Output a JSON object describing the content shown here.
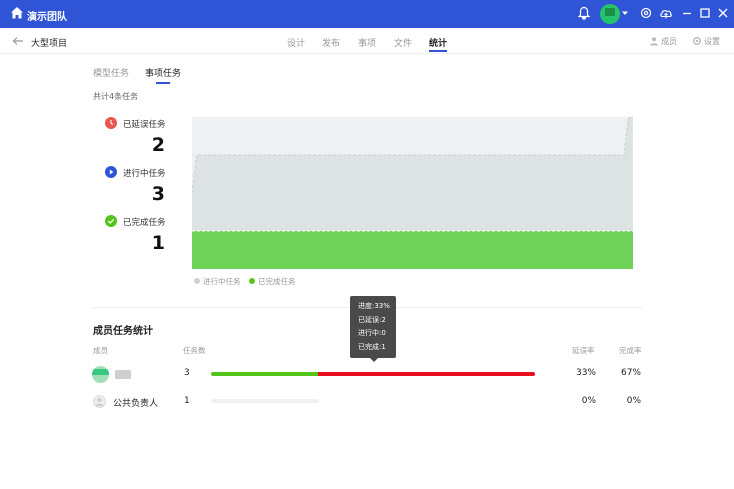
{
  "topbar": {
    "team_name": "演示团队",
    "bg": "#2f54d6"
  },
  "subnav": {
    "project": "大型项目",
    "tabs": [
      {
        "label": "设计",
        "active": false
      },
      {
        "label": "发布",
        "active": false
      },
      {
        "label": "事项",
        "active": false
      },
      {
        "label": "文件",
        "active": false
      },
      {
        "label": "统计",
        "active": true
      }
    ],
    "members_label": "成员",
    "settings_label": "设置"
  },
  "inner_tabs": [
    {
      "label": "模型任务",
      "active": false
    },
    {
      "label": "事项任务",
      "active": true
    }
  ],
  "total": "共计4条任务",
  "stats": [
    {
      "label": "已延误任务",
      "value": "2",
      "color": "#e8574d",
      "icon": "clock-icon"
    },
    {
      "label": "进行中任务",
      "value": "3",
      "color": "#2f54d6",
      "icon": "play-icon"
    },
    {
      "label": "已完成任务",
      "value": "1",
      "color": "#52c41a",
      "icon": "check-icon"
    }
  ],
  "chart_data": {
    "type": "area",
    "series": [
      {
        "name": "进行中任务",
        "color": "#dde2e3",
        "values": [
          2,
          3,
          3,
          3,
          3,
          3,
          3,
          3,
          3,
          3,
          3,
          3,
          3,
          3,
          3,
          3,
          3,
          3,
          3,
          3,
          3,
          3,
          3,
          3,
          3,
          3,
          3,
          3,
          3,
          3,
          3,
          3,
          3,
          3,
          3,
          3,
          3,
          3,
          3,
          3,
          3,
          3,
          3,
          3,
          3,
          3,
          3,
          3,
          3,
          3,
          3,
          3,
          3,
          3,
          3,
          3,
          3,
          3,
          3,
          3,
          3,
          3,
          3,
          3,
          3,
          3,
          3,
          3,
          3,
          3,
          3,
          3,
          3,
          3,
          3,
          3,
          3,
          3,
          3,
          3,
          3,
          3,
          3,
          3,
          3,
          3,
          3,
          3,
          3,
          3,
          3,
          3,
          3,
          3,
          3,
          3,
          3,
          4,
          4
        ]
      },
      {
        "name": "已完成任务",
        "color": "#6fd35a",
        "values": [
          1,
          1,
          1,
          1,
          1,
          1,
          1,
          1,
          1,
          1,
          1,
          1,
          1,
          1,
          1,
          1,
          1,
          1,
          1,
          1,
          1,
          1,
          1,
          1,
          1,
          1,
          1,
          1,
          1,
          1,
          1,
          1,
          1,
          1,
          1,
          1,
          1,
          1,
          1,
          1,
          1,
          1,
          1,
          1,
          1,
          1,
          1,
          1,
          1,
          1,
          1,
          1,
          1,
          1,
          1,
          1,
          1,
          1,
          1,
          1,
          1,
          1,
          1,
          1,
          1,
          1,
          1,
          1,
          1,
          1,
          1,
          1,
          1,
          1,
          1,
          1,
          1,
          1,
          1,
          1,
          1,
          1,
          1,
          1,
          1,
          1,
          1,
          1,
          1,
          1,
          1,
          1,
          1,
          1,
          1,
          1,
          1,
          1,
          1
        ]
      }
    ],
    "ylim": [
      0,
      4
    ],
    "grid": false,
    "legend_position": "bottom-left"
  },
  "tooltip": {
    "progress": "进度:33%",
    "delayed": "已延误:2",
    "in_progress": "进行中:0",
    "completed": "已完成:1"
  },
  "members": {
    "title": "成员任务统计",
    "headers": {
      "member": "成员",
      "task_count": "任务数",
      "delay_rate": "延误率",
      "completion_rate": "完成率"
    },
    "rows": [
      {
        "name": "",
        "count": "3",
        "done_fraction": 0.33,
        "rest_fraction": 0.67,
        "delay": "33%",
        "complete": "67%"
      },
      {
        "name": "公共负责人",
        "count": "1",
        "done_fraction": 0,
        "rest_fraction": 0,
        "delay": "0%",
        "complete": "0%"
      }
    ]
  }
}
